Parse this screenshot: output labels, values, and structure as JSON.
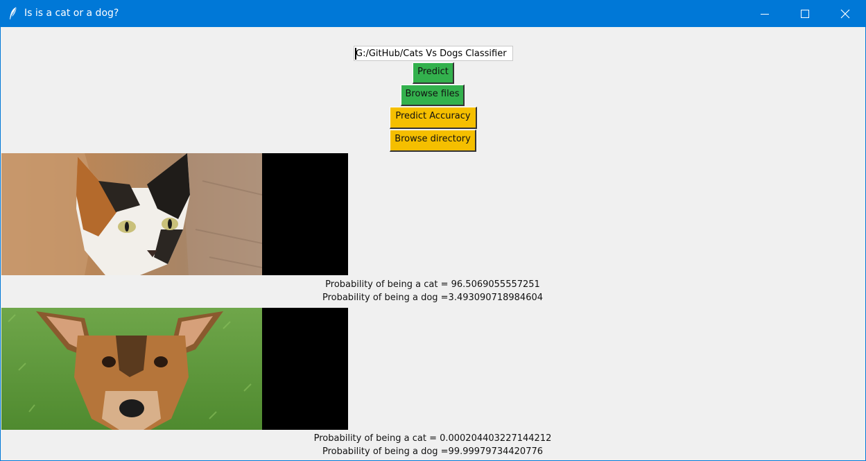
{
  "window": {
    "title": "Is is a cat or a dog?",
    "accent_color": "#0078d7",
    "icon": "feather-icon",
    "controls": [
      "minimize-icon",
      "maximize-icon",
      "close-icon"
    ]
  },
  "form": {
    "path_value": "G:/GitHub/Cats Vs Dogs Classifier",
    "predict_label": "Predict",
    "browse_files_label": "Browse files",
    "predict_accuracy_label": "Predict Accuracy",
    "browse_directory_label": "Browse directory",
    "green_button_color": "#33b14d",
    "yellow_button_color": "#f5bf00"
  },
  "results": [
    {
      "image": "cat-photo",
      "cat_line": "Probability of being a cat = 96.5069055557251",
      "dog_line": "Probability of being a dog =3.493090718984604"
    },
    {
      "image": "dog-photo",
      "cat_line": "Probability of being a cat = 0.000204403227144212",
      "dog_line": "Probability of being a dog =99.99979734420776"
    }
  ]
}
